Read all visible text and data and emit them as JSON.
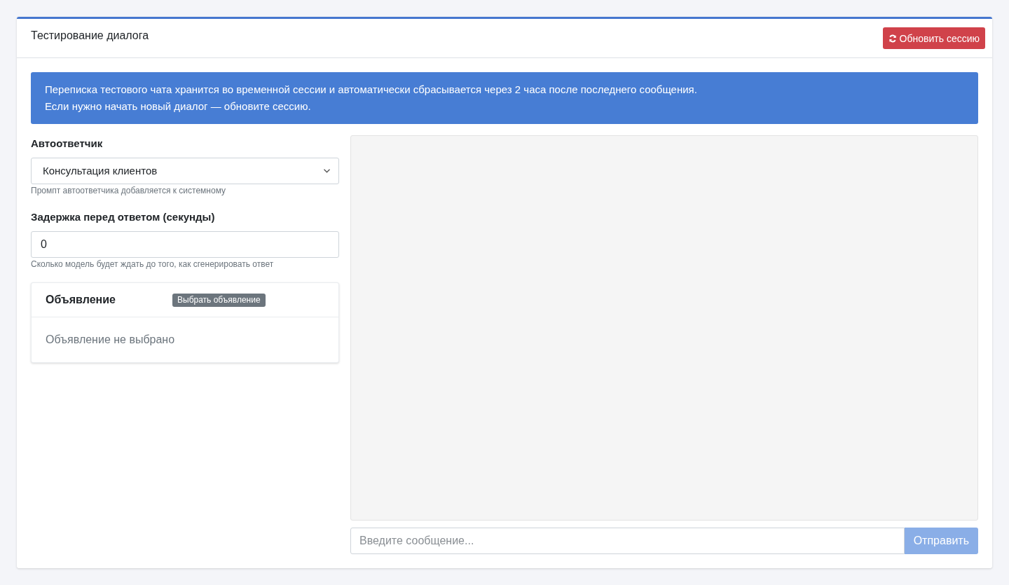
{
  "header": {
    "title": "Тестирование диалога",
    "refresh_button": {
      "label": "Обновить сессию"
    }
  },
  "notice": {
    "lines": [
      "Переписка тестового чата хранится во временной сессии и автоматически сбрасывается через 2 часа после последнего сообщения.",
      "Если нужно начать новый диалог — обновите сессию."
    ]
  },
  "settings": {
    "autoresponder": {
      "label": "Автоответчик",
      "value": "Консультация клиентов",
      "hint": "Промпт автоответчика добавляется к системному"
    },
    "delay": {
      "label": "Задержка перед ответом (секунды)",
      "value": "0",
      "hint": "Сколько модель будет ждать до того, как сгенерировать ответ"
    }
  },
  "listing": {
    "title": "Объявление",
    "select_button": {
      "label": "Выбрать объявление"
    },
    "empty_text": "Объявление не выбрано"
  },
  "chat": {
    "message_input": {
      "placeholder": "Введите сообщение..."
    },
    "send_button": {
      "label": "Отправить",
      "disabled": true
    }
  }
}
